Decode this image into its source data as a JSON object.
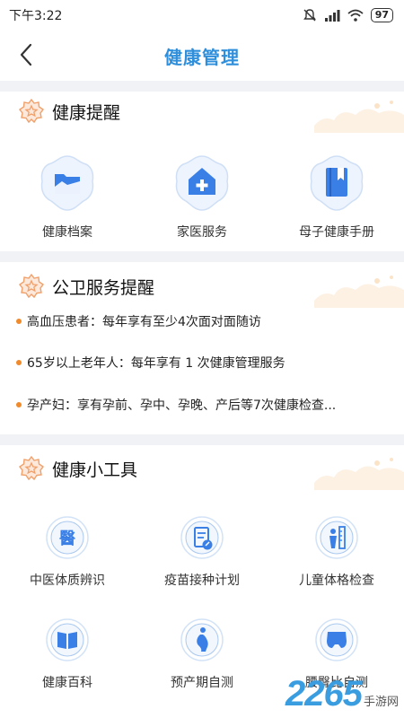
{
  "status_bar": {
    "time": "下午3:22",
    "battery": "97",
    "icons": [
      "mute-icon",
      "signal-icon",
      "wifi-icon",
      "battery-icon"
    ]
  },
  "nav": {
    "title": "健康管理",
    "back_icon": "chevron-left-icon"
  },
  "colors": {
    "accent": "#2f8fdb",
    "icon_blue": "#3a7fe6",
    "badge_orange": "#f0a06a",
    "bullet": "#f08a2b",
    "divider": "#f1f2f5"
  },
  "health_reminders": {
    "title": "健康提醒",
    "items": [
      {
        "label": "健康档案",
        "icon": "folder-icon"
      },
      {
        "label": "家医服务",
        "icon": "house-plus-icon"
      },
      {
        "label": "母子健康手册",
        "icon": "handbook-icon"
      }
    ]
  },
  "public_health": {
    "title": "公卫服务提醒",
    "items": [
      "高血压患者：每年享有至少4次面对面随访",
      "65岁以上老年人：每年享有 1 次健康管理服务",
      "孕产妇：享有孕前、孕中、孕晚、产后等7次健康检查..."
    ]
  },
  "health_tools": {
    "title": "健康小工具",
    "items": [
      {
        "label": "中医体质辨识",
        "icon": "tcm-icon"
      },
      {
        "label": "疫苗接种计划",
        "icon": "vaccine-plan-icon"
      },
      {
        "label": "儿童体格检查",
        "icon": "child-growth-icon"
      },
      {
        "label": "健康百科",
        "icon": "book-icon"
      },
      {
        "label": "预产期自测",
        "icon": "pregnancy-icon"
      },
      {
        "label": "腰臀比自测",
        "icon": "waist-hip-icon"
      }
    ]
  },
  "watermark": {
    "number": "2265",
    "text": "手游网"
  }
}
